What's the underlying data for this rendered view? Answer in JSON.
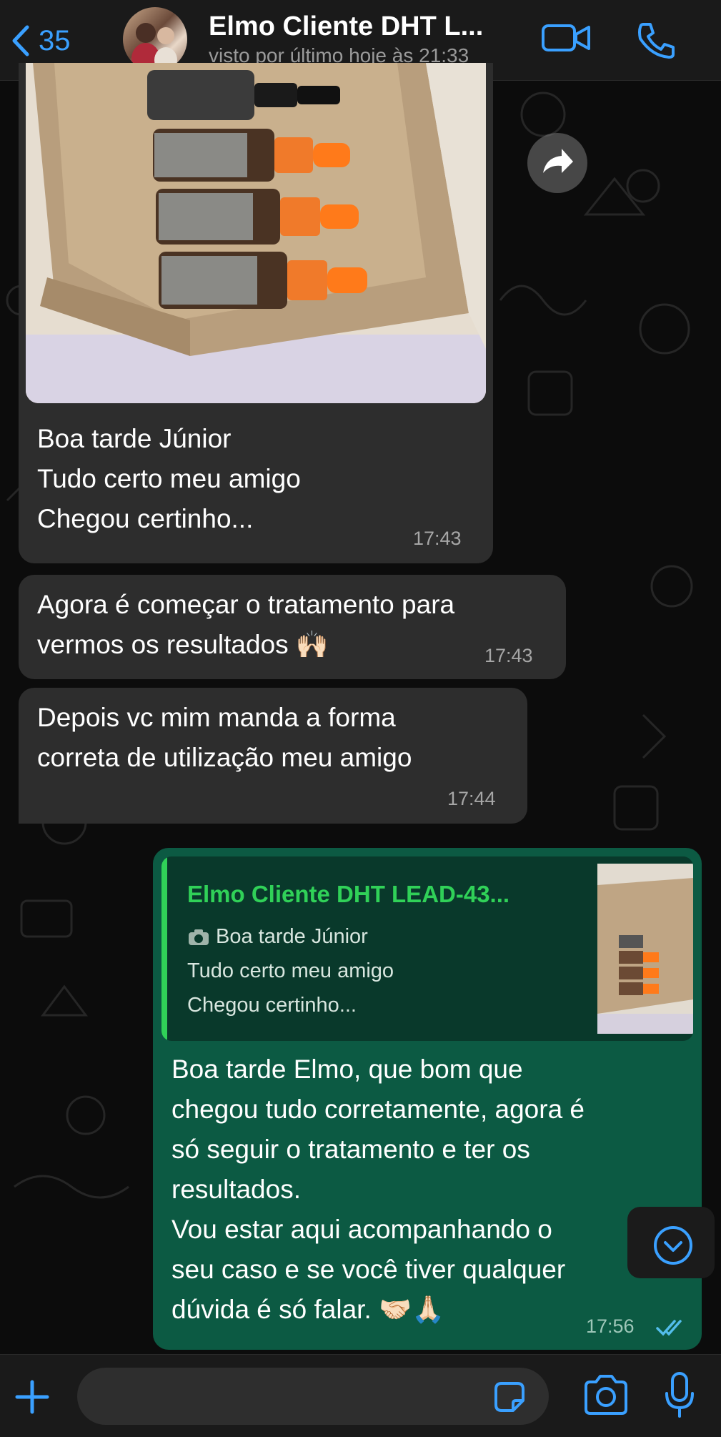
{
  "header": {
    "back_count": "35",
    "contact_name": "Elmo Cliente DHT L...",
    "last_seen": "visto por último hoje às 21:33",
    "icons": [
      "chevron-left-icon",
      "video-call-icon",
      "phone-icon"
    ]
  },
  "messages": [
    {
      "type": "image",
      "lines": [
        "Boa tarde Júnior",
        "Tudo certo meu amigo",
        "Chegou certinho..."
      ],
      "time": "17:43"
    },
    {
      "type": "text",
      "lines": [
        "Agora é começar o tratamento para",
        "vermos os resultados 🙌🏻"
      ],
      "time": "17:43"
    },
    {
      "type": "text",
      "lines": [
        "Depois vc mim manda a forma",
        "correta de utilização meu amigo"
      ],
      "time": "17:44"
    }
  ],
  "reply": {
    "quote_name": "Elmo Cliente DHT LEAD-43...",
    "quote_lines": [
      "Boa tarde Júnior",
      "Tudo certo meu amigo",
      "Chegou certinho..."
    ],
    "lines": [
      "Boa tarde Elmo, que bom que",
      "chegou tudo corretamente, agora é",
      "só seguir o tratamento e ter os",
      "resultados.",
      "Vou estar aqui acompanhando o",
      "seu caso e se você tiver qualquer",
      "dúvida é só falar. 🤝🏻🙏🏻"
    ],
    "time": "17:56",
    "status": "read"
  },
  "composer": {
    "icons": [
      "plus-icon",
      "sticker-icon",
      "camera-icon",
      "microphone-icon"
    ]
  },
  "colors": {
    "accent": "#3aa0ff",
    "outgoing_bubble": "#0c5a43",
    "incoming_bubble": "#2d2d2d",
    "quote_name": "#30d158"
  }
}
